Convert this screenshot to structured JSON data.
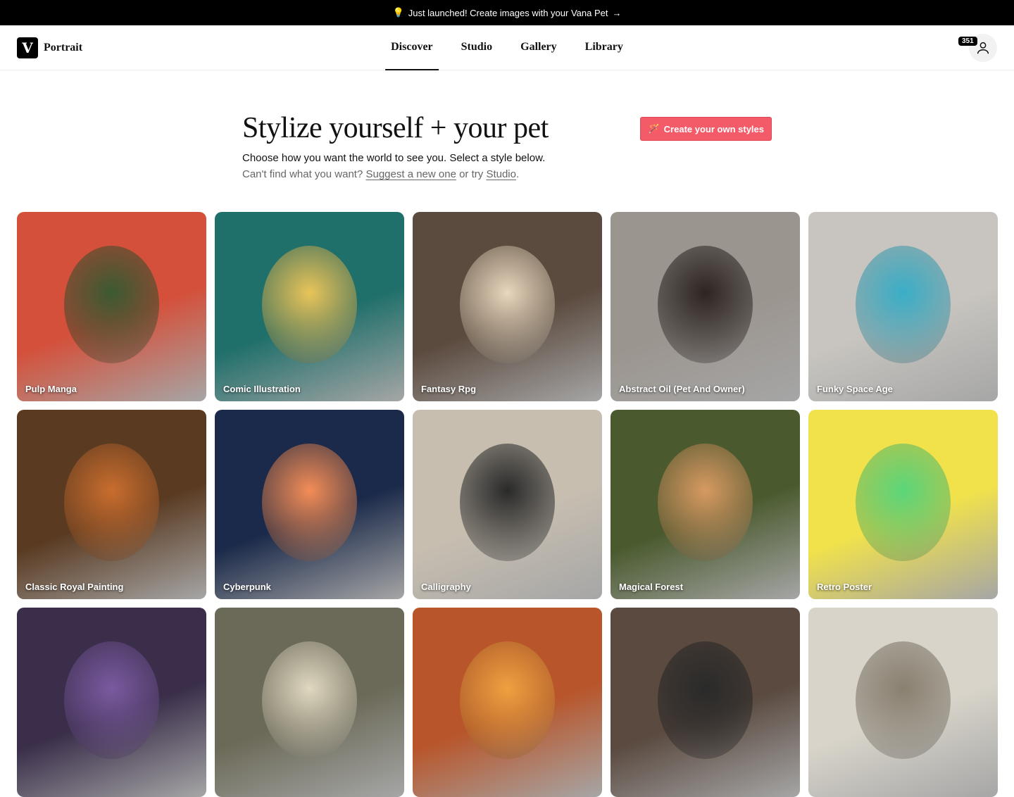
{
  "banner": {
    "icon": "lightbulb-icon",
    "text": "Just launched! Create images with your Vana Pet",
    "arrow": "→"
  },
  "nav": {
    "logo_letter": "V",
    "brand": "Portrait",
    "tabs": [
      {
        "label": "Discover",
        "active": true
      },
      {
        "label": "Studio",
        "active": false
      },
      {
        "label": "Gallery",
        "active": false
      },
      {
        "label": "Library",
        "active": false
      }
    ],
    "credits": "351",
    "account_icon": "user-icon"
  },
  "hero": {
    "title": "Stylize yourself + your pet",
    "subtitle": "Choose how you want the world to see you. Select a style below.",
    "suggest_prefix": "Can't find what you want?",
    "suggest_link": "Suggest a new one",
    "suggest_middle": "or try",
    "studio_link": "Studio",
    "suggest_suffix": ".",
    "create_button": "Create your own styles",
    "create_icon": "magic-wand-icon",
    "accent_color": "#f45b69"
  },
  "styles": [
    {
      "label": "Pulp Manga",
      "bg": "#d4503a",
      "fg": "#3b5a32"
    },
    {
      "label": "Comic Illustration",
      "bg": "#1f6f6a",
      "fg": "#e9c45a"
    },
    {
      "label": "Fantasy Rpg",
      "bg": "#5b4a3e",
      "fg": "#e8d7bd"
    },
    {
      "label": "Abstract Oil (Pet And Owner)",
      "bg": "#9b958f",
      "fg": "#2d2521"
    },
    {
      "label": "Funky Space Age",
      "bg": "#c8c5c0",
      "fg": "#3aaec7"
    },
    {
      "label": "Classic Royal Painting",
      "bg": "#5a3b22",
      "fg": "#c96d2e"
    },
    {
      "label": "Cyberpunk",
      "bg": "#1b2a4a",
      "fg": "#f38d57"
    },
    {
      "label": "Calligraphy",
      "bg": "#c7beb0",
      "fg": "#2a2a2a"
    },
    {
      "label": "Magical Forest",
      "bg": "#4a5a2e",
      "fg": "#d79a62"
    },
    {
      "label": "Retro Poster",
      "bg": "#f1e24b",
      "fg": "#5bd67a"
    },
    {
      "label": "",
      "bg": "#3a2e4a",
      "fg": "#7a5aa0"
    },
    {
      "label": "",
      "bg": "#6b6a58",
      "fg": "#e0d8c0"
    },
    {
      "label": "",
      "bg": "#b8552a",
      "fg": "#f0a040"
    },
    {
      "label": "",
      "bg": "#5a4a40",
      "fg": "#2a2a2a"
    },
    {
      "label": "",
      "bg": "#d8d4ca",
      "fg": "#8a8070"
    }
  ]
}
